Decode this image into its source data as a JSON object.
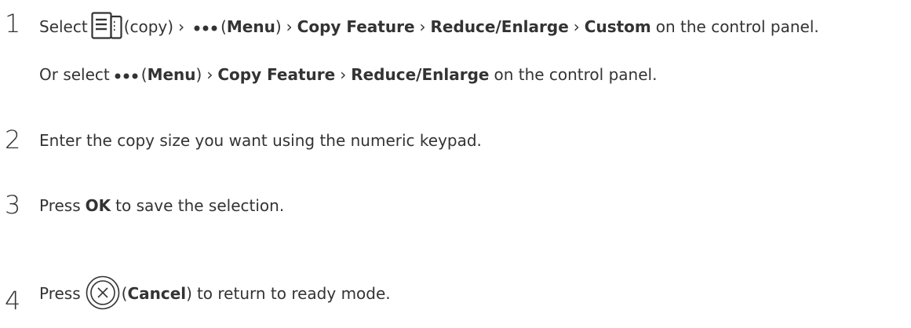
{
  "steps": [
    {
      "number": "1",
      "line1": {
        "select": "Select",
        "copy": "(copy)",
        "sep": "›",
        "menu_open": "(",
        "menu": "Menu",
        "menu_close": ")",
        "copy_feature": "Copy Feature",
        "reduce_enlarge": "Reduce/Enlarge",
        "custom": "Custom",
        "tail": "on the control panel."
      },
      "line2": {
        "or_select": "Or select",
        "menu_open": "(",
        "menu": "Menu",
        "menu_close": ")",
        "sep": "›",
        "copy_feature": "Copy Feature",
        "reduce_enlarge": "Reduce/Enlarge",
        "tail": "on the control panel."
      }
    },
    {
      "number": "2",
      "text": "Enter the copy size you want using the numeric keypad."
    },
    {
      "number": "3",
      "press": "Press",
      "ok": "OK",
      "tail": "to save the selection."
    },
    {
      "number": "4",
      "press": "Press",
      "paren_open": "(",
      "cancel": "Cancel",
      "paren_close": ")",
      "tail": "to return to ready mode."
    }
  ],
  "icons": {
    "copy": "copy-icon",
    "menu": "menu-dots-icon",
    "cancel": "cancel-icon"
  },
  "colors": {
    "text": "#333333",
    "number": "#333333"
  }
}
